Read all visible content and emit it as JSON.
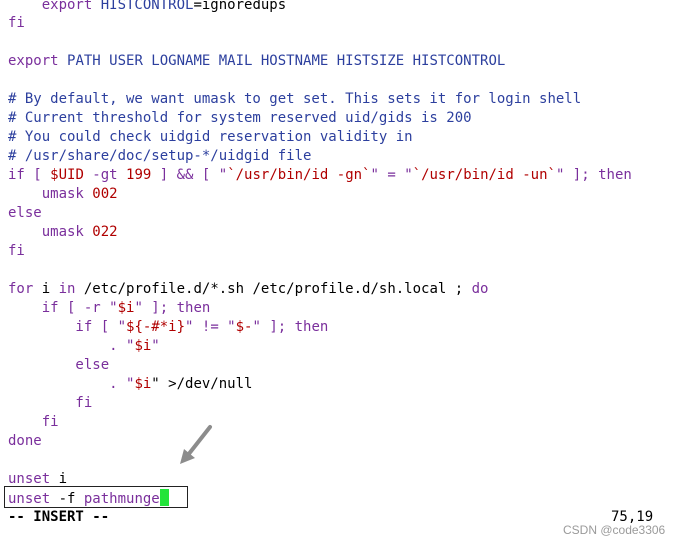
{
  "editor": {
    "mode": "-- INSERT --",
    "cursor_position": "75,19",
    "watermark": "CSDN @code3306",
    "lines": {
      "l1_a": "    export ",
      "l1_b": "HISTCONTROL",
      "l1_c": "=ignoredups",
      "l2": "fi",
      "l4_a": "export ",
      "l4_b": "PATH USER LOGNAME MAIL HOSTNAME HISTSIZE HISTCONTROL",
      "l6": "# By default, we want umask to get set. This sets it for login shell",
      "l7": "# Current threshold for system reserved uid/gids is 200",
      "l8": "# You could check uidgid reservation validity in",
      "l9": "# /usr/share/doc/setup-*/uidgid file",
      "l10_a": "if [ ",
      "l10_b": "$UID",
      "l10_c": " -gt ",
      "l10_d": "199",
      "l10_e": " ] && [ \"",
      "l10_f": "`/usr/bin/id -gn`",
      "l10_g": "\" = \"",
      "l10_h": "`/usr/bin/id -un`",
      "l10_i": "\" ]; ",
      "l10_j": "then",
      "l11_a": "    umask ",
      "l11_b": "002",
      "l12": "else",
      "l13_a": "    umask ",
      "l13_b": "022",
      "l14": "fi",
      "l16_a": "for",
      "l16_b": " i ",
      "l16_c": "in",
      "l16_d": " /etc/profile.d/*.sh /etc/profile.d/sh.local ; ",
      "l16_e": "do",
      "l17_a": "    if [ -r \"",
      "l17_b": "$i",
      "l17_c": "\" ]; ",
      "l17_d": "then",
      "l18_a": "        if [ \"",
      "l18_b": "${-#*i}",
      "l18_c": "\" != \"",
      "l18_d": "$-",
      "l18_e": "\" ]; ",
      "l18_f": "then",
      "l19_a": "            . \"",
      "l19_b": "$i",
      "l19_c": "\"",
      "l20": "        else",
      "l21_a": "            . \"",
      "l21_b": "$i",
      "l21_c": "\" >/dev/null",
      "l22": "        fi",
      "l23": "    fi",
      "l24": "done",
      "l26_a": "unset",
      "l26_b": " i",
      "l27_a": "unset",
      "l27_b": " -f ",
      "l27_c": "pathmunge"
    }
  }
}
